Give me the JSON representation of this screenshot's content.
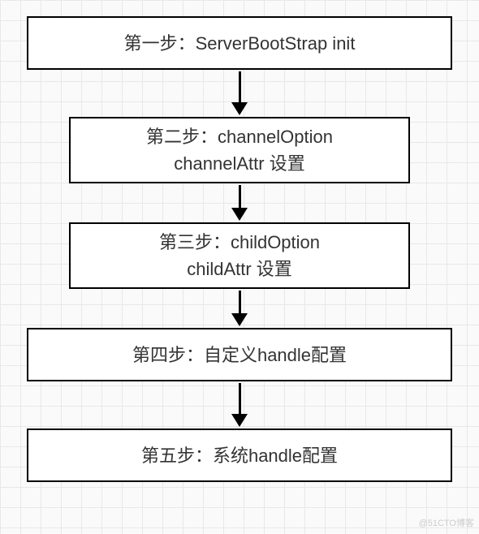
{
  "chart_data": {
    "type": "flowchart",
    "title": "",
    "direction": "top-to-bottom",
    "nodes": [
      {
        "id": "n1",
        "lines": [
          "第一步：ServerBootStrap init"
        ]
      },
      {
        "id": "n2",
        "lines": [
          "第二步：channelOption",
          "channelAttr 设置"
        ]
      },
      {
        "id": "n3",
        "lines": [
          "第三步：childOption",
          "childAttr 设置"
        ]
      },
      {
        "id": "n4",
        "lines": [
          "第四步：自定义handle配置"
        ]
      },
      {
        "id": "n5",
        "lines": [
          "第五步：系统handle配置"
        ]
      }
    ],
    "edges": [
      {
        "from": "n1",
        "to": "n2"
      },
      {
        "from": "n2",
        "to": "n3"
      },
      {
        "from": "n3",
        "to": "n4"
      },
      {
        "from": "n4",
        "to": "n5"
      }
    ]
  },
  "steps": {
    "step1": {
      "line1": "第一步：ServerBootStrap init"
    },
    "step2": {
      "line1": "第二步：channelOption",
      "line2": "channelAttr 设置"
    },
    "step3": {
      "line1": "第三步：childOption",
      "line2": "childAttr 设置"
    },
    "step4": {
      "line1": "第四步：自定义handle配置"
    },
    "step5": {
      "line1": "第五步：系统handle配置"
    }
  },
  "watermark": "@51CTO博客"
}
